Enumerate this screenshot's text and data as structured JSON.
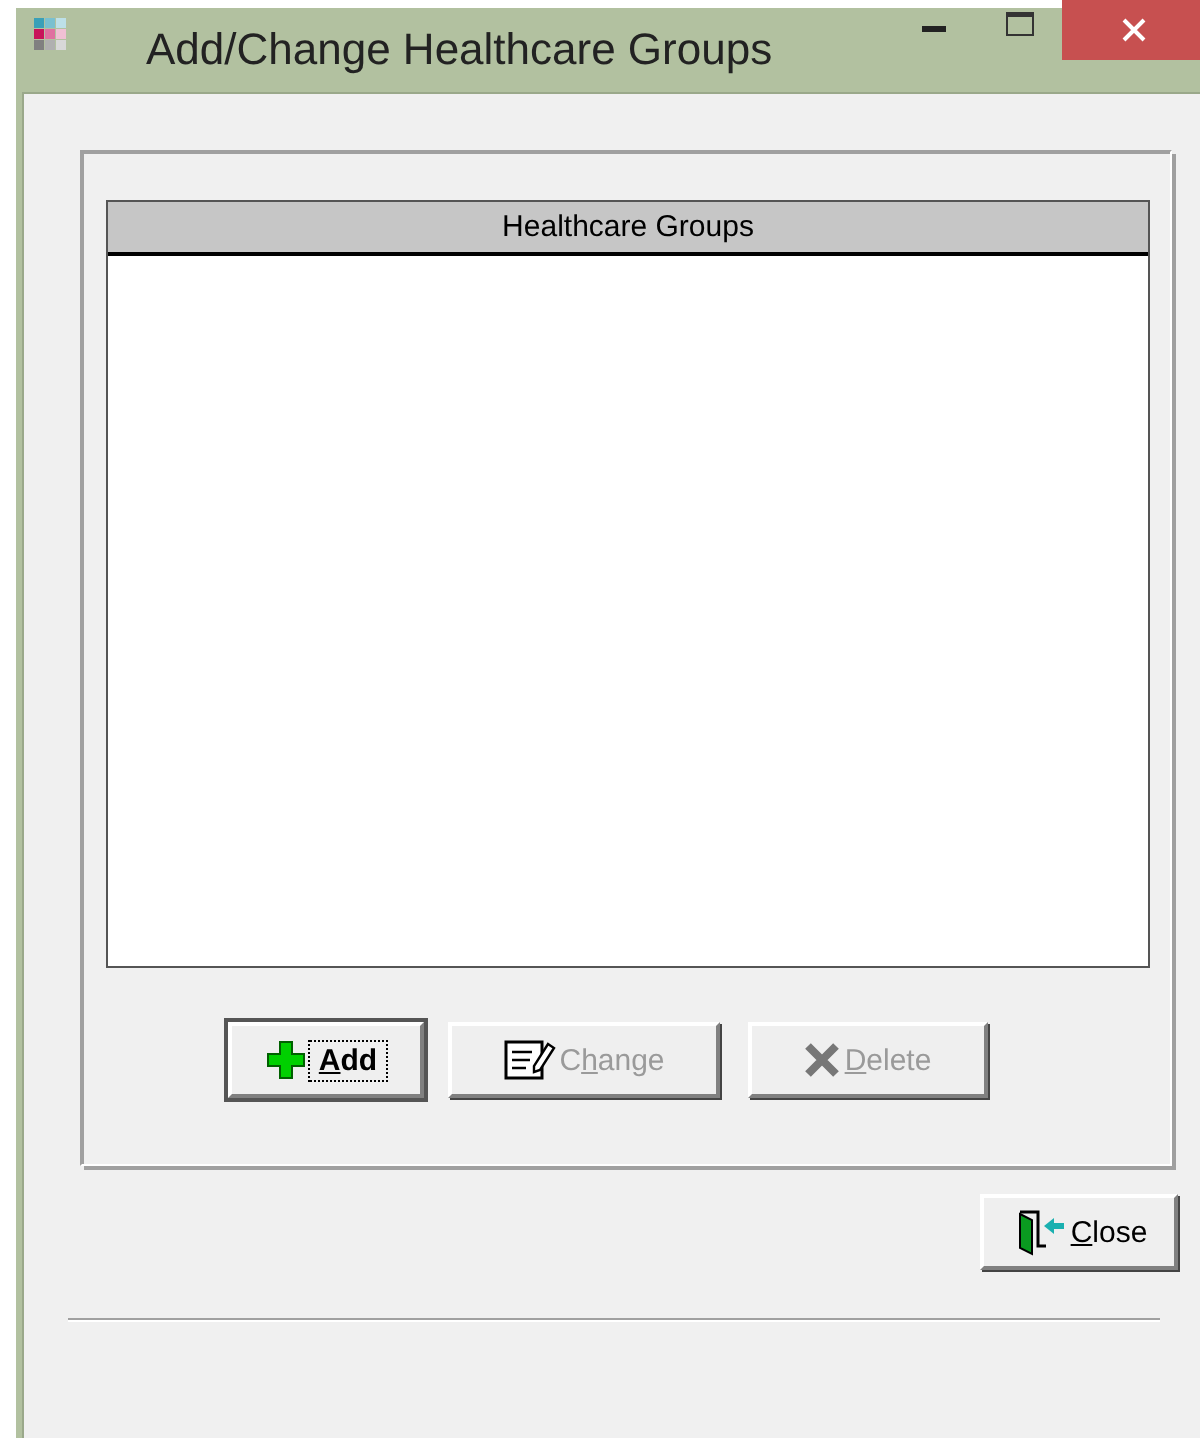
{
  "window": {
    "title": "Add/Change Healthcare Groups"
  },
  "list": {
    "header": "Healthcare Groups"
  },
  "buttons": [
    {
      "kind": "add",
      "label": [
        {
          "text": "A",
          "underlined": true
        },
        {
          "text": "dd",
          "underlined": false
        }
      ],
      "default": true,
      "disabled": false
    },
    {
      "kind": "change",
      "label": [
        {
          "text": "C",
          "underlined": false
        },
        {
          "text": "h",
          "underlined": true
        },
        {
          "text": "ange",
          "underlined": false
        }
      ],
      "default": false,
      "disabled": true
    },
    {
      "kind": "delete",
      "label": [
        {
          "text": "D",
          "underlined": true
        },
        {
          "text": "elete",
          "underlined": false
        }
      ],
      "default": false,
      "disabled": true
    }
  ],
  "close_button": {
    "kind": "close",
    "label": [
      {
        "text": "C",
        "underlined": true
      },
      {
        "text": "lose",
        "underlined": false
      }
    ],
    "default": false,
    "disabled": false
  }
}
